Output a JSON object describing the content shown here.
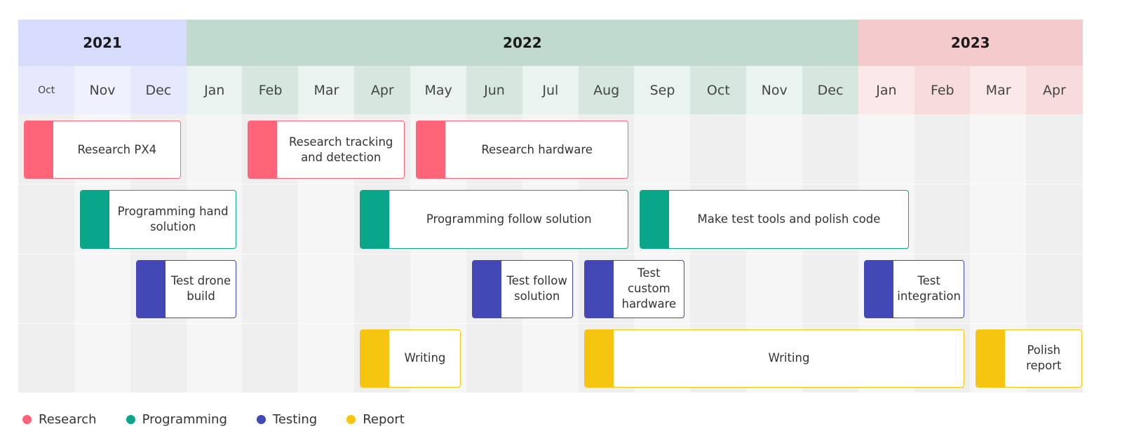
{
  "categories": [
    {
      "key": "research",
      "label": "Research",
      "color": "#ff6478"
    },
    {
      "key": "programming",
      "label": "Programming",
      "color": "#0aa689"
    },
    {
      "key": "testing",
      "label": "Testing",
      "color": "#4248b5"
    },
    {
      "key": "report",
      "label": "Report",
      "color": "#f6c510"
    }
  ],
  "years": [
    {
      "label": "2021",
      "months": 3,
      "color": "#d7dcfd",
      "light": "#eef0fe",
      "dark": "#e3e6fd"
    },
    {
      "label": "2022",
      "months": 12,
      "color": "#c0dacf",
      "light": "#eaf3ef",
      "dark": "#d6e7df"
    },
    {
      "label": "2023",
      "months": 4,
      "color": "#f4cacc",
      "light": "#fbe9ea",
      "dark": "#f8dbdc"
    }
  ],
  "months": [
    "Oct",
    "Nov",
    "Dec",
    "Jan",
    "Feb",
    "Mar",
    "Apr",
    "May",
    "Jun",
    "Jul",
    "Aug",
    "Sep",
    "Oct",
    "Nov",
    "Dec",
    "Jan",
    "Feb",
    "Mar",
    "Apr"
  ],
  "tasks": [
    {
      "category": "research",
      "row": 0,
      "start": 0,
      "end": 2.9,
      "lines": [
        "Research PX4"
      ]
    },
    {
      "category": "research",
      "row": 0,
      "start": 4,
      "end": 6.9,
      "lines": [
        "Research tracking",
        "and detection"
      ]
    },
    {
      "category": "research",
      "row": 0,
      "start": 7,
      "end": 10.9,
      "lines": [
        "Research hardware"
      ]
    },
    {
      "category": "programming",
      "row": 1,
      "start": 1,
      "end": 3.9,
      "lines": [
        "Programming hand",
        "solution"
      ]
    },
    {
      "category": "programming",
      "row": 1,
      "start": 6,
      "end": 10.9,
      "lines": [
        "Programming follow solution"
      ]
    },
    {
      "category": "programming",
      "row": 1,
      "start": 11,
      "end": 15.9,
      "lines": [
        "Make test tools and polish code"
      ]
    },
    {
      "category": "testing",
      "row": 2,
      "start": 2,
      "end": 3.9,
      "lines": [
        "Test drone",
        "build"
      ]
    },
    {
      "category": "testing",
      "row": 2,
      "start": 8,
      "end": 9.9,
      "lines": [
        "Test follow",
        "solution"
      ]
    },
    {
      "category": "testing",
      "row": 2,
      "start": 10,
      "end": 11.9,
      "lines": [
        "Test",
        "custom",
        "hardware"
      ]
    },
    {
      "category": "testing",
      "row": 2,
      "start": 15,
      "end": 16.9,
      "lines": [
        "Test",
        "integration"
      ]
    },
    {
      "category": "report",
      "row": 3,
      "start": 6,
      "end": 7.9,
      "lines": [
        "Writing"
      ]
    },
    {
      "category": "report",
      "row": 3,
      "start": 10,
      "end": 16.9,
      "lines": [
        "Writing"
      ]
    },
    {
      "category": "report",
      "row": 3,
      "start": 17,
      "end": 19,
      "lines": [
        "Polish",
        "report"
      ]
    }
  ]
}
